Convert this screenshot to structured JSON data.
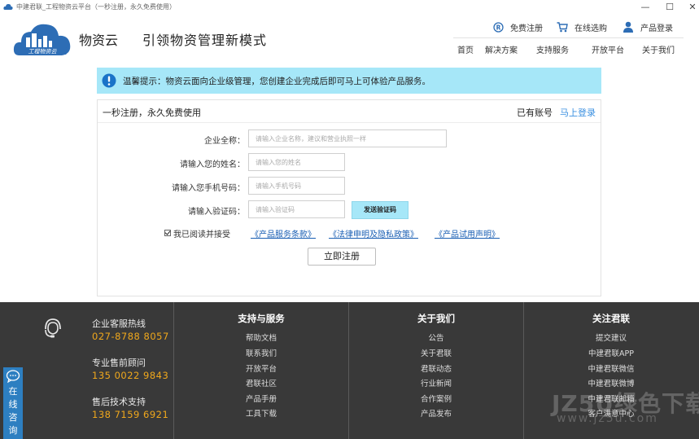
{
  "window": {
    "title": "中建君联_工程物资云平台（一秒注册，永久免费使用）",
    "min_glyph": "—",
    "max_glyph": "☐",
    "close_glyph": "✕"
  },
  "header": {
    "logo_text": "工程物资云",
    "brand": "物资云",
    "slogan": "引领物资管理新模式",
    "top_links": {
      "register": "免费注册",
      "shop": "在线选购",
      "login": "产品登录"
    },
    "nav": [
      "首页",
      "解决方案",
      "支持服务",
      "开放平台",
      "关于我们"
    ]
  },
  "notice": {
    "text": "温馨提示：物资云面向企业级管理，您创建企业完成后即可马上可体验产品服务。"
  },
  "form": {
    "title": "一秒注册，永久免费使用",
    "have_account": "已有账号",
    "login_link": "马上登录",
    "company": {
      "label": "企业全称：",
      "placeholder": "请输入企业名称，建议和营业执照一样"
    },
    "name": {
      "label": "请输入您的姓名：",
      "placeholder": "请输入您的姓名"
    },
    "phone": {
      "label": "请输入您手机号码：",
      "placeholder": "请输入手机号码"
    },
    "code": {
      "label": "请输入验证码：",
      "placeholder": "请输入验证码"
    },
    "send_code": "发送验证码",
    "agree_text": "我已阅读并接受",
    "agree_checked": true,
    "docs": [
      "《产品服务条款》",
      "《法律申明及隐私政策》",
      "《产品试用声明》"
    ],
    "submit": "立即注册"
  },
  "footer": {
    "contacts": [
      {
        "label": "企业客服热线",
        "phone": "027-8788 8057"
      },
      {
        "label": "专业售前顾问",
        "phone": "135 0022 9843"
      },
      {
        "label": "售后技术支持",
        "phone": "138 7159 6921"
      }
    ],
    "columns": [
      {
        "title": "支持与服务",
        "items": [
          "帮助文档",
          "联系我们",
          "开放平台",
          "君联社区",
          "产品手册",
          "工具下载"
        ]
      },
      {
        "title": "关于我们",
        "items": [
          "公告",
          "关于君联",
          "君联动态",
          "行业新闻",
          "合作案例",
          "产品发布"
        ]
      },
      {
        "title": "关注君联",
        "items": [
          "提交建议",
          "中建君联APP",
          "中建君联微信",
          "中建君联微博",
          "中建君联邮箱",
          "客户满意中心"
        ]
      }
    ]
  },
  "side_chat": {
    "label": "在线咨询"
  },
  "watermark": {
    "main": "JZ5U绿色下载",
    "sub": "www.jz5u.com"
  },
  "colors": {
    "notice_bg": "#a6e7f8",
    "footer_bg": "#393939",
    "phone": "#f0a81c",
    "link": "#1a5fb4",
    "side_chat": "#2d7fc1"
  }
}
